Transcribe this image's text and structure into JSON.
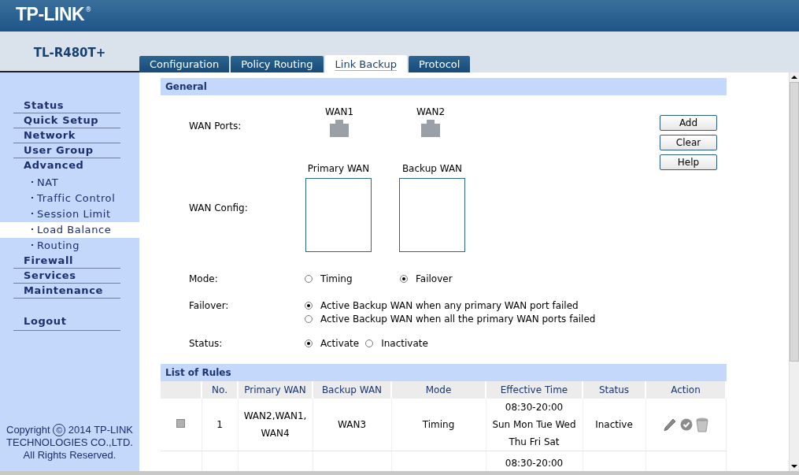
{
  "header": {
    "logo": "TP-LINK",
    "registered": "®"
  },
  "model": "TL-R480T+",
  "tabs": [
    {
      "label": "Configuration",
      "selected": false
    },
    {
      "label": "Policy Routing",
      "selected": false
    },
    {
      "label": "Link Backup",
      "selected": true
    },
    {
      "label": "Protocol",
      "selected": false
    }
  ],
  "sidebar": {
    "items": [
      {
        "label": "Status",
        "kind": "main",
        "selected": false
      },
      {
        "label": "Quick Setup",
        "kind": "main",
        "selected": false
      },
      {
        "label": "Network",
        "kind": "main",
        "selected": false
      },
      {
        "label": "User Group",
        "kind": "main",
        "selected": false
      },
      {
        "label": "Advanced",
        "kind": "group",
        "selected": false
      },
      {
        "label": "NAT",
        "kind": "sub",
        "selected": false
      },
      {
        "label": "Traffic Control",
        "kind": "sub",
        "selected": false
      },
      {
        "label": "Session Limit",
        "kind": "sub",
        "selected": false
      },
      {
        "label": "Load Balance",
        "kind": "sub",
        "selected": true
      },
      {
        "label": "Routing",
        "kind": "sub",
        "selected": false
      },
      {
        "label": "Firewall",
        "kind": "main",
        "selected": false
      },
      {
        "label": "Services",
        "kind": "main",
        "selected": false
      },
      {
        "label": "Maintenance",
        "kind": "main",
        "selected": false
      },
      {
        "label": "Logout",
        "kind": "logout",
        "selected": false
      }
    ],
    "copyright": {
      "prefix": "Copyright",
      "symbol": "©",
      "text": "2014 TP-LINK TECHNOLOGIES CO.,LTD. All Rights Reserved."
    }
  },
  "general": {
    "title": "General",
    "wan_ports": {
      "label": "WAN Ports:",
      "ports": [
        "WAN1",
        "WAN2"
      ]
    },
    "wan_config": {
      "label": "WAN Config:",
      "lists": [
        "Primary WAN",
        "Backup WAN"
      ]
    },
    "mode": {
      "label": "Mode:",
      "options": [
        {
          "label": "Timing",
          "selected": false
        },
        {
          "label": "Failover",
          "selected": true
        }
      ]
    },
    "failover": {
      "label": "Failover:",
      "options": [
        {
          "label": "Active Backup WAN when any primary WAN port failed",
          "selected": true
        },
        {
          "label": "Active Backup WAN when all the primary WAN ports failed",
          "selected": false
        }
      ]
    },
    "status": {
      "label": "Status:",
      "options": [
        {
          "label": "Activate",
          "selected": true
        },
        {
          "label": "Inactivate",
          "selected": false
        }
      ]
    },
    "buttons": [
      "Add",
      "Clear",
      "Help"
    ]
  },
  "rules": {
    "title": "List of Rules",
    "columns": [
      "No.",
      "Primary WAN",
      "Backup WAN",
      "Mode",
      "Effective Time",
      "Status",
      "Action"
    ],
    "rows": [
      {
        "checked": false,
        "no": "1",
        "primary_wan": [
          "WAN2,WAN1,",
          "WAN4"
        ],
        "backup_wan": "WAN3",
        "mode": "Timing",
        "effective_time": [
          "08:30-20:00",
          "Sun Mon Tue Wed",
          "Thu Fri Sat"
        ],
        "status": "Inactive"
      },
      {
        "effective_time": [
          "08:30-20:00"
        ]
      }
    ]
  }
}
